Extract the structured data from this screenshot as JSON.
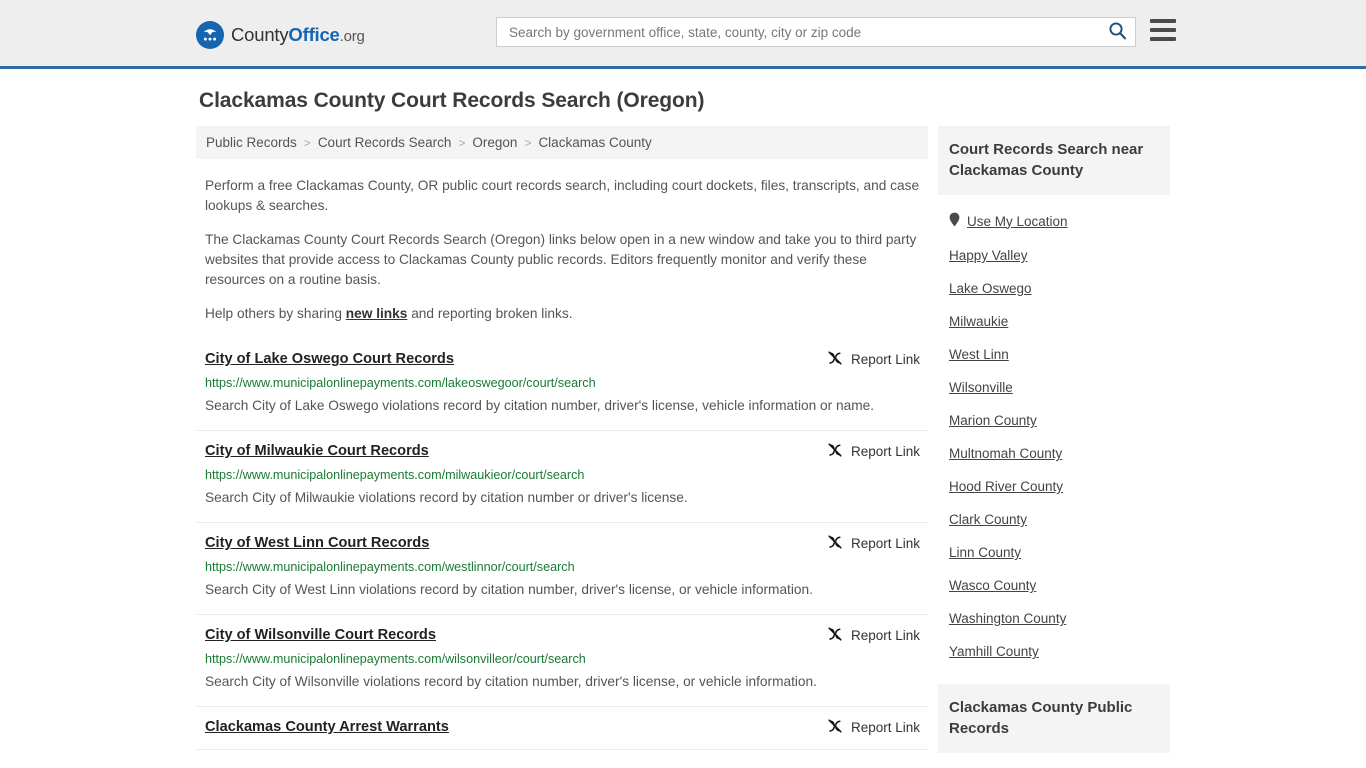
{
  "header": {
    "brand": {
      "part1": "County",
      "part2": "Office",
      "part3": ".org",
      "logo_icon": "eagle-stars-seal-icon"
    },
    "search": {
      "placeholder": "Search by government office, state, county, city or zip code",
      "value": "",
      "icon": "search-icon"
    },
    "menu_icon": "hamburger-menu-icon",
    "accent_color": "#2e6da4",
    "background_color": "#eeeeee"
  },
  "page": {
    "title": "Clackamas County Court Records Search (Oregon)"
  },
  "breadcrumb": {
    "separator": ">",
    "items": [
      {
        "label": "Public Records"
      },
      {
        "label": "Court Records Search"
      },
      {
        "label": "Oregon"
      },
      {
        "label": "Clackamas County"
      }
    ]
  },
  "intro": {
    "paragraph1": "Perform a free Clackamas County, OR public court records search, including court dockets, files, transcripts, and case lookups & searches.",
    "paragraph2": "The Clackamas County Court Records Search (Oregon) links below open in a new window and take you to third party websites that provide access to Clackamas County public records. Editors frequently monitor and verify these resources on a routine basis.",
    "paragraph3_before": "Help others by sharing ",
    "paragraph3_link": "new links",
    "paragraph3_after": " and reporting broken links."
  },
  "results": {
    "report_label": "Report Link",
    "report_icon": "broken-link-icon",
    "url_color": "#1a7a34",
    "items": [
      {
        "title": "City of Lake Oswego Court Records",
        "url": "https://www.municipalonlinepayments.com/lakeoswegoor/court/search",
        "description": "Search City of Lake Oswego violations record by citation number, driver's license, vehicle information or name."
      },
      {
        "title": "City of Milwaukie Court Records",
        "url": "https://www.municipalonlinepayments.com/milwaukieor/court/search",
        "description": "Search City of Milwaukie violations record by citation number or driver's license."
      },
      {
        "title": "City of West Linn Court Records",
        "url": "https://www.municipalonlinepayments.com/westlinnor/court/search",
        "description": "Search City of West Linn violations record by citation number, driver's license, or vehicle information."
      },
      {
        "title": "City of Wilsonville Court Records",
        "url": "https://www.municipalonlinepayments.com/wilsonvilleor/court/search",
        "description": "Search City of Wilsonville violations record by citation number, driver's license, or vehicle information."
      },
      {
        "title": "Clackamas County Arrest Warrants",
        "url": "",
        "description": ""
      }
    ]
  },
  "sidebar": {
    "box1_title": "Court Records Search near Clackamas County",
    "box2_title": "Clackamas County Public Records",
    "location_item": {
      "label": "Use My Location",
      "icon": "map-pin-icon"
    },
    "near_items": [
      {
        "label": "Happy Valley"
      },
      {
        "label": "Lake Oswego"
      },
      {
        "label": "Milwaukie"
      },
      {
        "label": "West Linn"
      },
      {
        "label": "Wilsonville"
      },
      {
        "label": "Marion County"
      },
      {
        "label": "Multnomah County"
      },
      {
        "label": "Hood River County"
      },
      {
        "label": "Clark County"
      },
      {
        "label": "Linn County"
      },
      {
        "label": "Wasco County"
      },
      {
        "label": "Washington County"
      },
      {
        "label": "Yamhill County"
      }
    ]
  }
}
